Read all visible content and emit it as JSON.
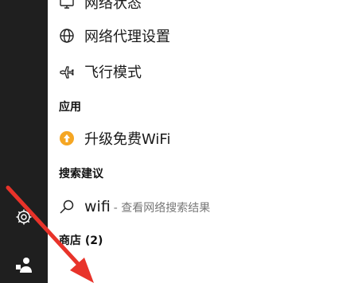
{
  "rail": {
    "settings_icon": "gear-icon",
    "user_icon": "user-icon"
  },
  "results": {
    "network_status": {
      "label": "网络状态",
      "icon": "monitor-icon"
    },
    "proxy": {
      "label": "网络代理设置",
      "icon": "globe-icon"
    },
    "airplane": {
      "label": "飞行模式",
      "icon": "airplane-icon"
    }
  },
  "sections": {
    "apps": "应用",
    "suggestions": "搜索建议",
    "store": "商店 (2)"
  },
  "apps": {
    "wifi_upgrade": {
      "label": "升级免费WiFi",
      "icon": "upgrade-icon"
    }
  },
  "suggestions": {
    "query": "wifi",
    "hint": "- 查看网络搜索结果",
    "icon": "search-icon"
  },
  "colors": {
    "rail_bg": "#1f1f1f",
    "app_badge": "#f5a623",
    "annotation_arrow": "#e8332a"
  }
}
